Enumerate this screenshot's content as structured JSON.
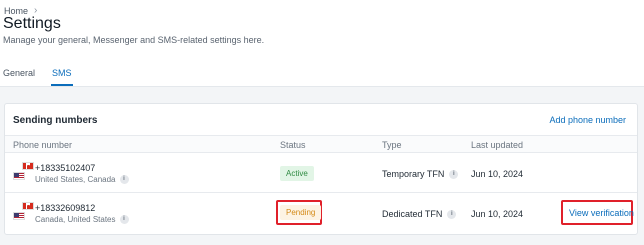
{
  "breadcrumb": {
    "home": "Home"
  },
  "header": {
    "title": "Settings",
    "subtitle": "Manage your general, Messenger and SMS-related settings here."
  },
  "tabs": [
    {
      "label": "General",
      "active": false
    },
    {
      "label": "SMS",
      "active": true
    }
  ],
  "card": {
    "title": "Sending numbers",
    "add_label": "Add phone number",
    "columns": {
      "phone": "Phone number",
      "status": "Status",
      "type": "Type",
      "updated": "Last updated"
    },
    "rows": [
      {
        "phone": "+18335102407",
        "region": "United States, Canada",
        "status": "Active",
        "type": "Temporary TFN",
        "updated": "Jun 10, 2024",
        "action": ""
      },
      {
        "phone": "+18332609812",
        "region": "Canada, United States",
        "status": "Pending",
        "type": "Dedicated TFN",
        "updated": "Jun 10, 2024",
        "action": "View verification"
      }
    ]
  },
  "colors": {
    "accent": "#0b6dbb",
    "active_badge_bg": "#e2f5e6",
    "active_badge_text": "#2f8a42",
    "pending_badge_bg": "#fdf3e3",
    "pending_badge_text": "#d48a17",
    "highlight": "#e0202a"
  }
}
